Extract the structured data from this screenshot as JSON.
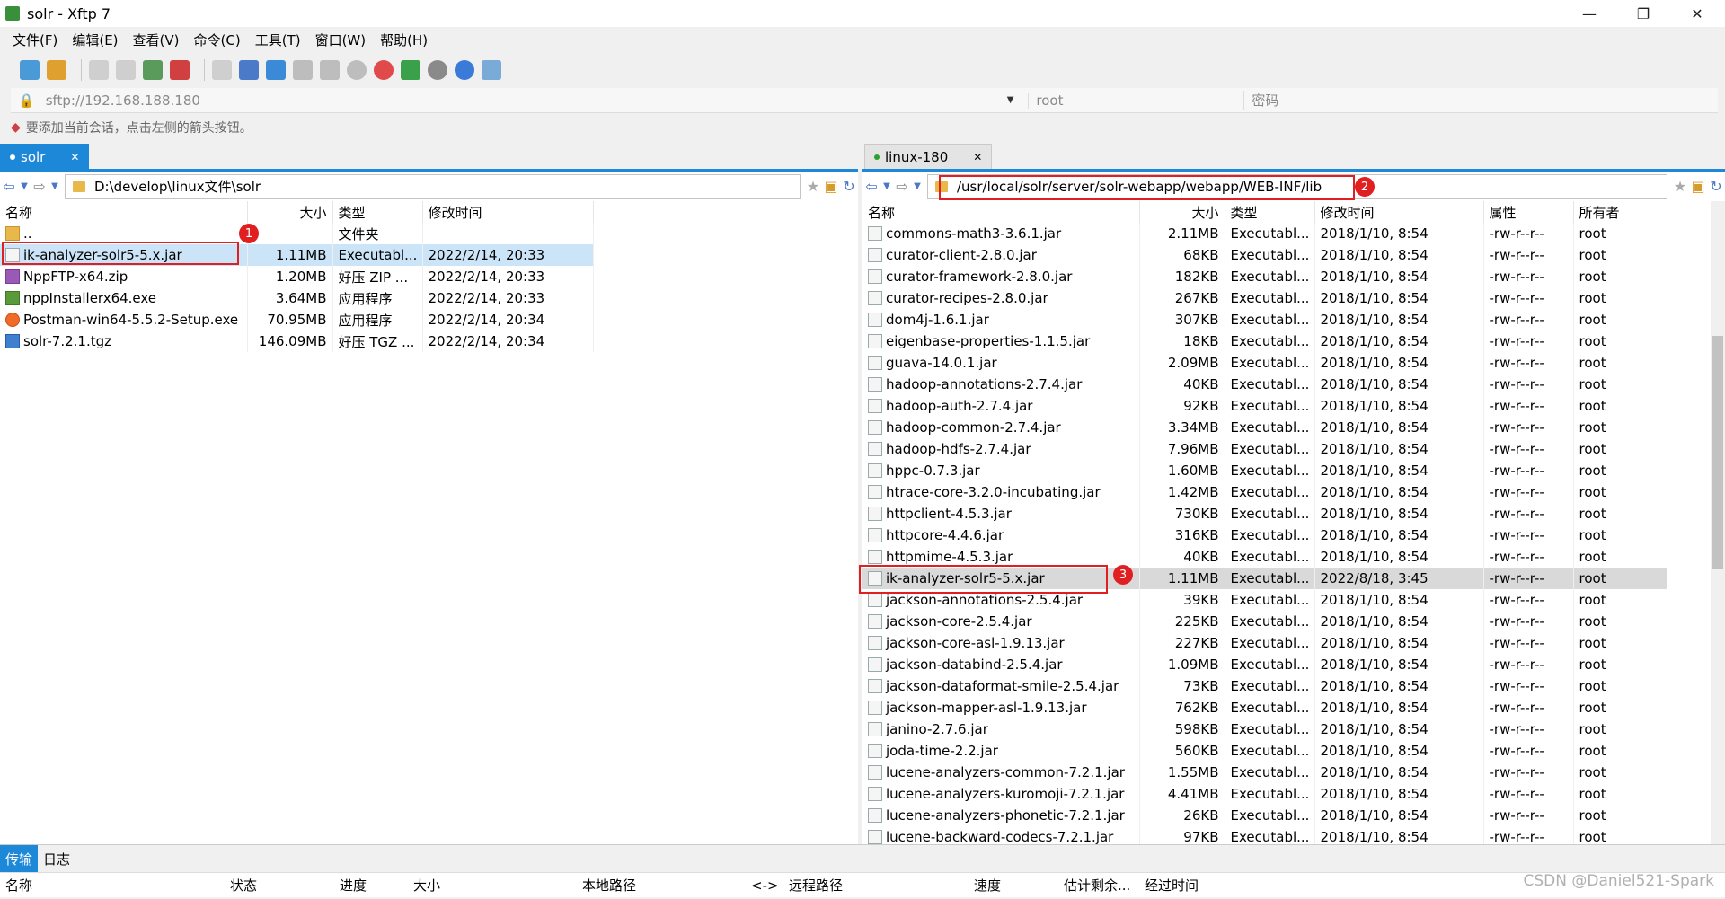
{
  "window": {
    "title": "solr - Xftp 7",
    "minimize": "—",
    "maximize": "❐",
    "close": "✕"
  },
  "menu": [
    "文件(F)",
    "编辑(E)",
    "查看(V)",
    "命令(C)",
    "工具(T)",
    "窗口(W)",
    "帮助(H)"
  ],
  "address": {
    "url": "sftp://192.168.188.180",
    "user": "root",
    "password_placeholder": "密码"
  },
  "hint": "要添加当前会话，点击左侧的箭头按钮。",
  "left_pane": {
    "tab_label": "solr",
    "path": "D:\\develop\\linux文件\\solr",
    "columns": [
      "名称",
      "大小",
      "类型",
      "修改时间"
    ],
    "rows": [
      {
        "name": "..",
        "size": "",
        "type": "文件夹",
        "mtime": "",
        "icon": "folder"
      },
      {
        "name": "ik-analyzer-solr5-5.x.jar",
        "size": "1.11MB",
        "type": "Executabl...",
        "mtime": "2022/2/14, 20:33",
        "icon": "jar"
      },
      {
        "name": "NppFTP-x64.zip",
        "size": "1.20MB",
        "type": "好压 ZIP ...",
        "mtime": "2022/2/14, 20:33",
        "icon": "zip"
      },
      {
        "name": "nppInstallerx64.exe",
        "size": "3.64MB",
        "type": "应用程序",
        "mtime": "2022/2/14, 20:33",
        "icon": "exe"
      },
      {
        "name": "Postman-win64-5.5.2-Setup.exe",
        "size": "70.95MB",
        "type": "应用程序",
        "mtime": "2022/2/14, 20:34",
        "icon": "post"
      },
      {
        "name": "solr-7.2.1.tgz",
        "size": "146.09MB",
        "type": "好压 TGZ ...",
        "mtime": "2022/2/14, 20:34",
        "icon": "tgz"
      }
    ]
  },
  "right_pane": {
    "tab_label": "linux-180",
    "path": "/usr/local/solr/server/solr-webapp/webapp/WEB-INF/lib",
    "columns": [
      "名称",
      "大小",
      "类型",
      "修改时间",
      "属性",
      "所有者"
    ],
    "rows": [
      {
        "name": "commons-math3-3.6.1.jar",
        "size": "2.11MB",
        "mtime": "2018/1/10, 8:54"
      },
      {
        "name": "curator-client-2.8.0.jar",
        "size": "68KB",
        "mtime": "2018/1/10, 8:54"
      },
      {
        "name": "curator-framework-2.8.0.jar",
        "size": "182KB",
        "mtime": "2018/1/10, 8:54"
      },
      {
        "name": "curator-recipes-2.8.0.jar",
        "size": "267KB",
        "mtime": "2018/1/10, 8:54"
      },
      {
        "name": "dom4j-1.6.1.jar",
        "size": "307KB",
        "mtime": "2018/1/10, 8:54"
      },
      {
        "name": "eigenbase-properties-1.1.5.jar",
        "size": "18KB",
        "mtime": "2018/1/10, 8:54"
      },
      {
        "name": "guava-14.0.1.jar",
        "size": "2.09MB",
        "mtime": "2018/1/10, 8:54"
      },
      {
        "name": "hadoop-annotations-2.7.4.jar",
        "size": "40KB",
        "mtime": "2018/1/10, 8:54"
      },
      {
        "name": "hadoop-auth-2.7.4.jar",
        "size": "92KB",
        "mtime": "2018/1/10, 8:54"
      },
      {
        "name": "hadoop-common-2.7.4.jar",
        "size": "3.34MB",
        "mtime": "2018/1/10, 8:54"
      },
      {
        "name": "hadoop-hdfs-2.7.4.jar",
        "size": "7.96MB",
        "mtime": "2018/1/10, 8:54"
      },
      {
        "name": "hppc-0.7.3.jar",
        "size": "1.60MB",
        "mtime": "2018/1/10, 8:54"
      },
      {
        "name": "htrace-core-3.2.0-incubating.jar",
        "size": "1.42MB",
        "mtime": "2018/1/10, 8:54"
      },
      {
        "name": "httpclient-4.5.3.jar",
        "size": "730KB",
        "mtime": "2018/1/10, 8:54"
      },
      {
        "name": "httpcore-4.4.6.jar",
        "size": "316KB",
        "mtime": "2018/1/10, 8:54"
      },
      {
        "name": "httpmime-4.5.3.jar",
        "size": "40KB",
        "mtime": "2018/1/10, 8:54"
      },
      {
        "name": "ik-analyzer-solr5-5.x.jar",
        "size": "1.11MB",
        "mtime": "2022/8/18, 3:45"
      },
      {
        "name": "jackson-annotations-2.5.4.jar",
        "size": "39KB",
        "mtime": "2018/1/10, 8:54"
      },
      {
        "name": "jackson-core-2.5.4.jar",
        "size": "225KB",
        "mtime": "2018/1/10, 8:54"
      },
      {
        "name": "jackson-core-asl-1.9.13.jar",
        "size": "227KB",
        "mtime": "2018/1/10, 8:54"
      },
      {
        "name": "jackson-databind-2.5.4.jar",
        "size": "1.09MB",
        "mtime": "2018/1/10, 8:54"
      },
      {
        "name": "jackson-dataformat-smile-2.5.4.jar",
        "size": "73KB",
        "mtime": "2018/1/10, 8:54"
      },
      {
        "name": "jackson-mapper-asl-1.9.13.jar",
        "size": "762KB",
        "mtime": "2018/1/10, 8:54"
      },
      {
        "name": "janino-2.7.6.jar",
        "size": "598KB",
        "mtime": "2018/1/10, 8:54"
      },
      {
        "name": "joda-time-2.2.jar",
        "size": "560KB",
        "mtime": "2018/1/10, 8:54"
      },
      {
        "name": "lucene-analyzers-common-7.2.1.jar",
        "size": "1.55MB",
        "mtime": "2018/1/10, 8:54"
      },
      {
        "name": "lucene-analyzers-kuromoji-7.2.1.jar",
        "size": "4.41MB",
        "mtime": "2018/1/10, 8:54"
      },
      {
        "name": "lucene-analyzers-phonetic-7.2.1.jar",
        "size": "26KB",
        "mtime": "2018/1/10, 8:54"
      },
      {
        "name": "lucene-backward-codecs-7.2.1.jar",
        "size": "97KB",
        "mtime": "2018/1/10, 8:54"
      }
    ],
    "type_text": "Executabl...",
    "attr_text": "-rw-r--r--",
    "owner_text": "root"
  },
  "annotations": [
    "1",
    "2",
    "3"
  ],
  "bottom": {
    "tabs": [
      "传输",
      "日志"
    ],
    "columns": [
      "名称",
      "状态",
      "进度",
      "大小",
      "本地路径",
      "<->",
      "远程路径",
      "速度",
      "估计剩余...",
      "经过时间"
    ]
  },
  "watermark": "CSDN @Daniel521-Spark",
  "colors": {
    "accent": "#1e88d8",
    "annotation": "#e02020",
    "selection": "#cce4f7"
  }
}
